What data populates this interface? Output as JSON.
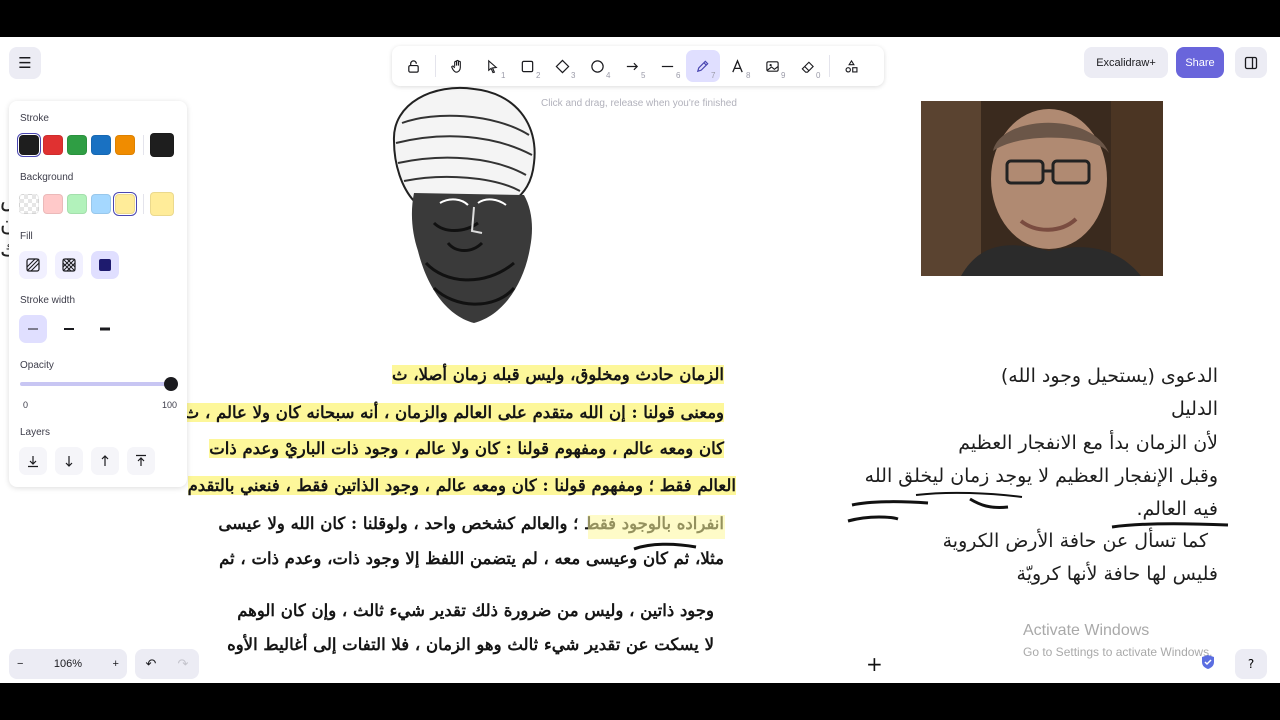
{
  "toolbar": {
    "tools": [
      {
        "name": "lock",
        "num": ""
      },
      {
        "name": "hand",
        "num": ""
      },
      {
        "name": "selection",
        "num": "1"
      },
      {
        "name": "rectangle",
        "num": "2"
      },
      {
        "name": "diamond",
        "num": "3"
      },
      {
        "name": "ellipse",
        "num": "4"
      },
      {
        "name": "arrow",
        "num": "5"
      },
      {
        "name": "line",
        "num": "6"
      },
      {
        "name": "draw",
        "num": "7"
      },
      {
        "name": "text",
        "num": "8"
      },
      {
        "name": "image",
        "num": "9"
      },
      {
        "name": "eraser",
        "num": "0"
      },
      {
        "name": "extra-tools",
        "num": ""
      }
    ],
    "active_tool": "draw",
    "hint": "Click and drag, release when you're finished"
  },
  "header": {
    "excalidraw_plus": "Excalidraw+",
    "share": "Share"
  },
  "panel": {
    "stroke_label": "Stroke",
    "stroke_colors": [
      "#1e1e1e",
      "#e03131",
      "#2f9e44",
      "#1971c2",
      "#f08c00"
    ],
    "stroke_current": "#1e1e1e",
    "background_label": "Background",
    "background_colors": [
      "transparent",
      "#ffc9c9",
      "#b2f2bb",
      "#a5d8ff",
      "#ffec99"
    ],
    "background_current": "#ffec99",
    "fill_label": "Fill",
    "stroke_width_label": "Stroke width",
    "opacity_label": "Opacity",
    "opacity_min": "0",
    "opacity_max": "100",
    "opacity_value": 100,
    "layers_label": "Layers"
  },
  "footer": {
    "zoom": "106%",
    "zoom_out": "−",
    "zoom_in": "+"
  },
  "scan_lines": [
    {
      "text": "الزمان حادث ومخلوق، وليس قبله زمان أصلا، ث",
      "highlight": true
    },
    {
      "text": "ومعنى قولنا : إن الله متقدم على العالم والزمان ، أنه سبحانه كان ولا عالم ، ث",
      "highlight": true
    },
    {
      "text": "كان ومعه عالم ، ومفهوم قولنا : كان ولا عالم ، وجود ذات الباريْ وعدم ذات",
      "highlight": true
    },
    {
      "text": "العالم فقط ؛ ومفهوم قولنا : كان ومعه عالم ، وجود الذاتين فقط ، فنعني بالتقدم",
      "highlight": true
    },
    {
      "text": "انفراده بالوجود فقط ؛ والعالم كشخص واحد ، ولوقلنا : كان الله ولا عيسى",
      "highlight": false
    },
    {
      "text": "مثلا، ثم كان وعيسى معه ، لم يتضمن اللفظ إلا وجود ذات، وعدم ذات ، ثم",
      "highlight": false
    },
    {
      "text": "وجود ذاتين ، وليس من ضرورة ذلك تقدير شيء ثالث ، وإن كان الوهم",
      "highlight": false
    },
    {
      "text": "لا يسكت عن تقدير شيء ثالث وهو الزمان ، فلا التفات إلى أغاليط الأوه",
      "highlight": false
    }
  ],
  "notes": [
    "الدعوى (يستحيل وجود الله)",
    "الدليل",
    "لأن الزمان بدأ مع الانفجار العظيم",
    "وقبل الإنفجار العظيم لا يوجد زمان ليخلق الله",
    "فيه العالم.",
    "كما تسأل عن حافة الأرض الكروية",
    "فليس لها حافة لأنها كرويّة"
  ],
  "watermark": {
    "title": "Activate Windows",
    "subtitle": "Go to Settings to activate Windows."
  }
}
